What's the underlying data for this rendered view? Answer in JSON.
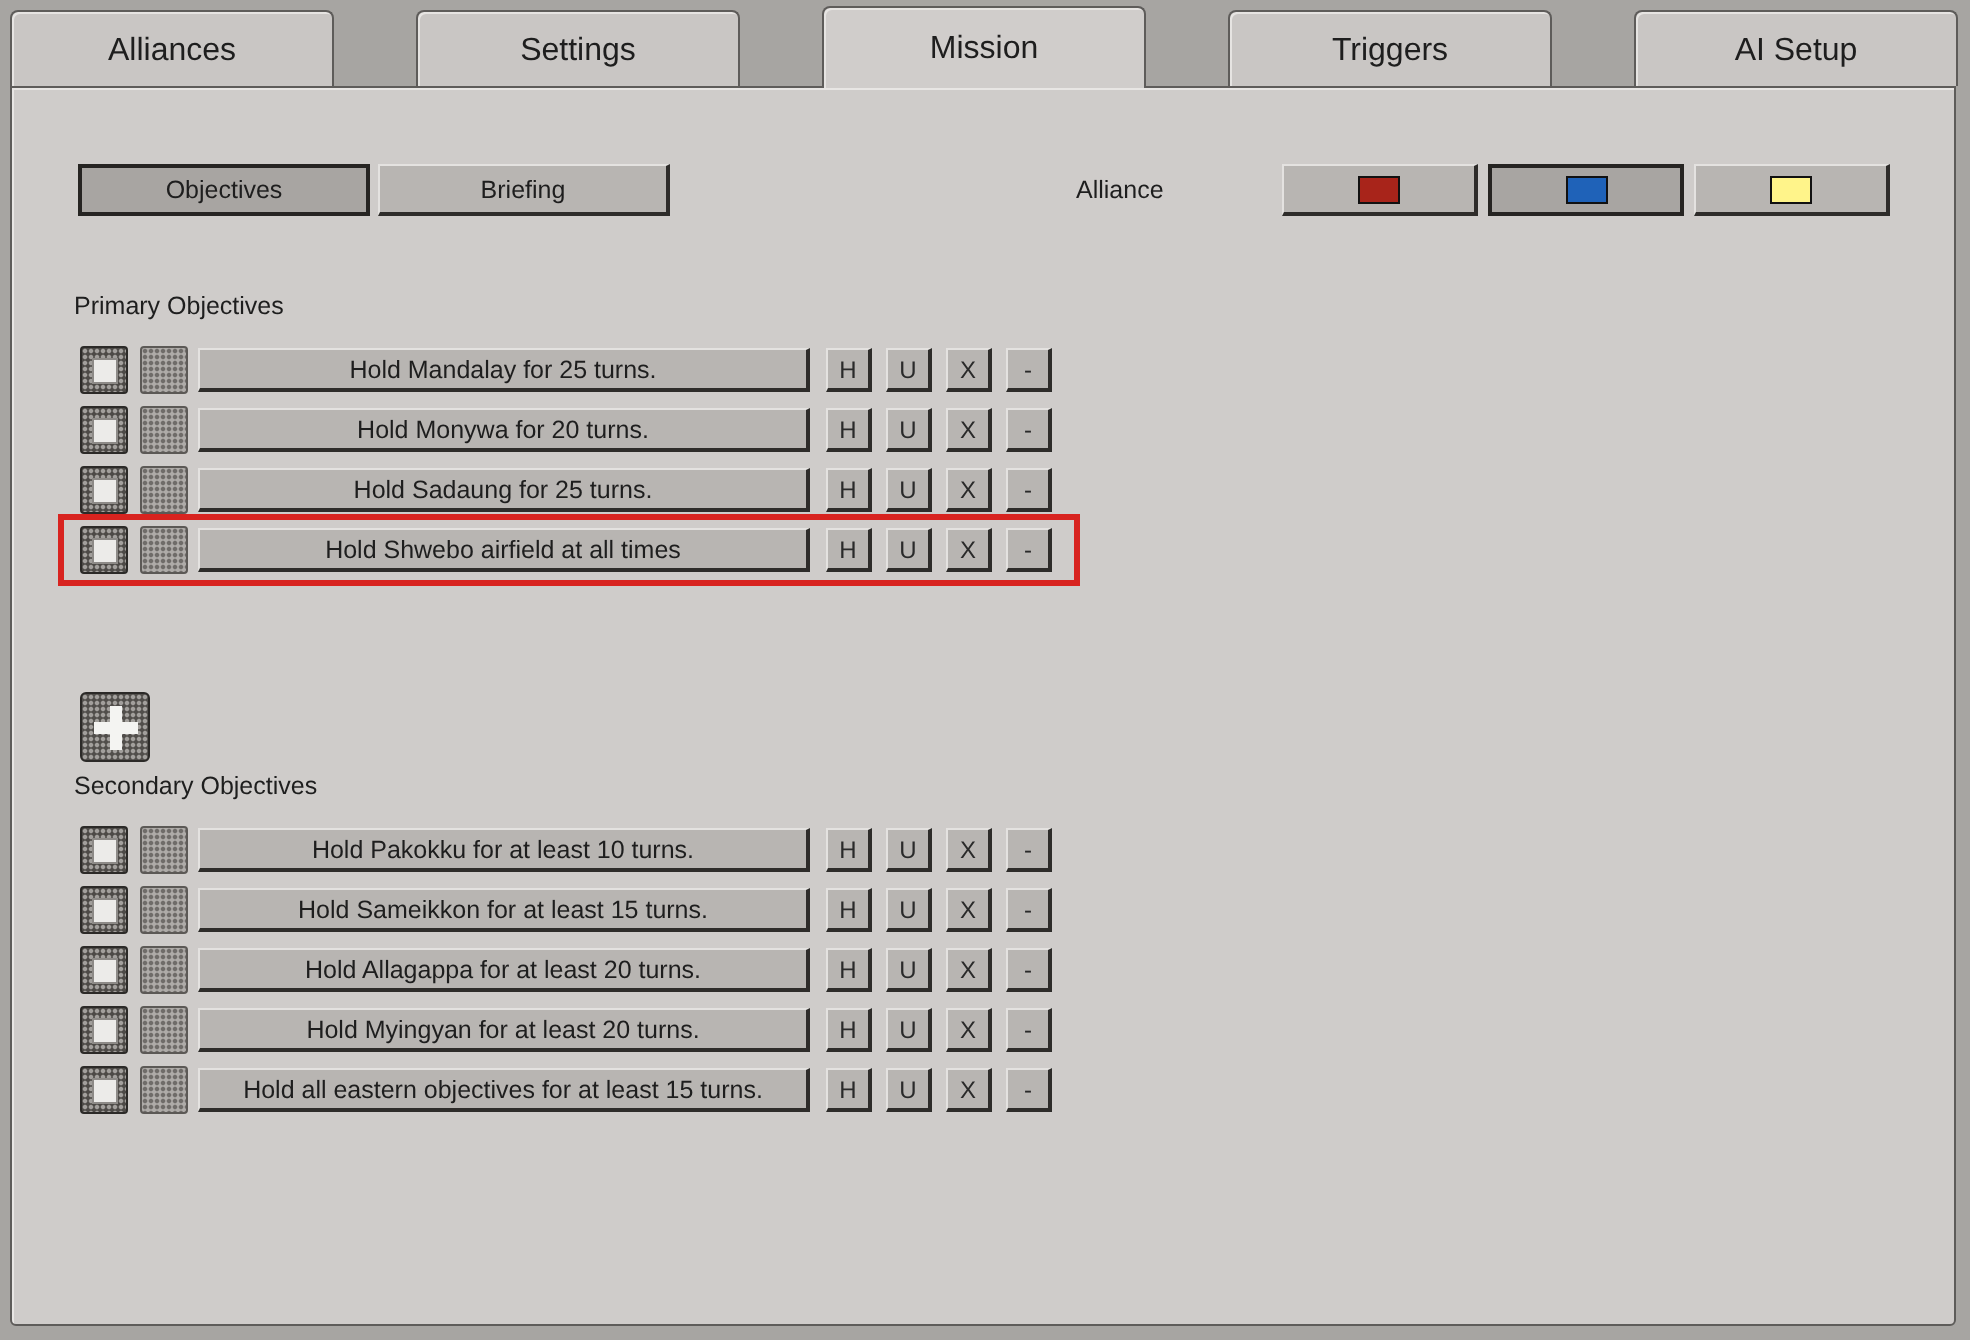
{
  "tabs": [
    {
      "label": "Alliances",
      "selected": false
    },
    {
      "label": "Settings",
      "selected": false
    },
    {
      "label": "Mission",
      "selected": true
    },
    {
      "label": "Triggers",
      "selected": false
    },
    {
      "label": "AI Setup",
      "selected": false
    }
  ],
  "mission": {
    "subtabs": [
      {
        "label": "Objectives",
        "selected": true
      },
      {
        "label": "Briefing",
        "selected": false
      }
    ],
    "alliance": {
      "label": "Alliance",
      "options": [
        {
          "color": "#a8241a",
          "selected": false
        },
        {
          "color": "#1f62b8",
          "selected": true
        },
        {
          "color": "#fff48a",
          "selected": false
        }
      ]
    },
    "primary_objectives": {
      "title": "Primary Objectives",
      "rows": [
        {
          "toggles": [
            {
              "checked": true
            },
            {
              "checked": false
            }
          ],
          "text": "Hold Mandalay for 25 turns.",
          "highlighted": false,
          "actions": [
            "H",
            "U",
            "X",
            "-"
          ]
        },
        {
          "toggles": [
            {
              "checked": true
            },
            {
              "checked": false
            }
          ],
          "text": "Hold Monywa for 20 turns.",
          "highlighted": false,
          "actions": [
            "H",
            "U",
            "X",
            "-"
          ]
        },
        {
          "toggles": [
            {
              "checked": true
            },
            {
              "checked": false
            }
          ],
          "text": "Hold Sadaung for 25 turns.",
          "highlighted": false,
          "actions": [
            "H",
            "U",
            "X",
            "-"
          ]
        },
        {
          "toggles": [
            {
              "checked": true
            },
            {
              "checked": false
            }
          ],
          "text": "Hold Shwebo airfield at all times",
          "highlighted": true,
          "actions": [
            "H",
            "U",
            "X",
            "-"
          ]
        }
      ]
    },
    "secondary_objectives": {
      "title": "Secondary Objectives",
      "rows": [
        {
          "toggles": [
            {
              "checked": true
            },
            {
              "checked": false
            }
          ],
          "text": "Hold Pakokku for at least 10 turns.",
          "highlighted": false,
          "actions": [
            "H",
            "U",
            "X",
            "-"
          ]
        },
        {
          "toggles": [
            {
              "checked": true
            },
            {
              "checked": false
            }
          ],
          "text": "Hold Sameikkon for at least 15 turns.",
          "highlighted": false,
          "actions": [
            "H",
            "U",
            "X",
            "-"
          ]
        },
        {
          "toggles": [
            {
              "checked": true
            },
            {
              "checked": false
            }
          ],
          "text": "Hold Allagappa for at least 20 turns.",
          "highlighted": false,
          "actions": [
            "H",
            "U",
            "X",
            "-"
          ]
        },
        {
          "toggles": [
            {
              "checked": true
            },
            {
              "checked": false
            }
          ],
          "text": "Hold Myingyan for at least 20 turns.",
          "highlighted": false,
          "actions": [
            "H",
            "U",
            "X",
            "-"
          ]
        },
        {
          "toggles": [
            {
              "checked": true
            },
            {
              "checked": false
            }
          ],
          "text": "Hold all eastern objectives for at least 15 turns.",
          "highlighted": false,
          "actions": [
            "H",
            "U",
            "X",
            "-"
          ]
        }
      ]
    }
  }
}
